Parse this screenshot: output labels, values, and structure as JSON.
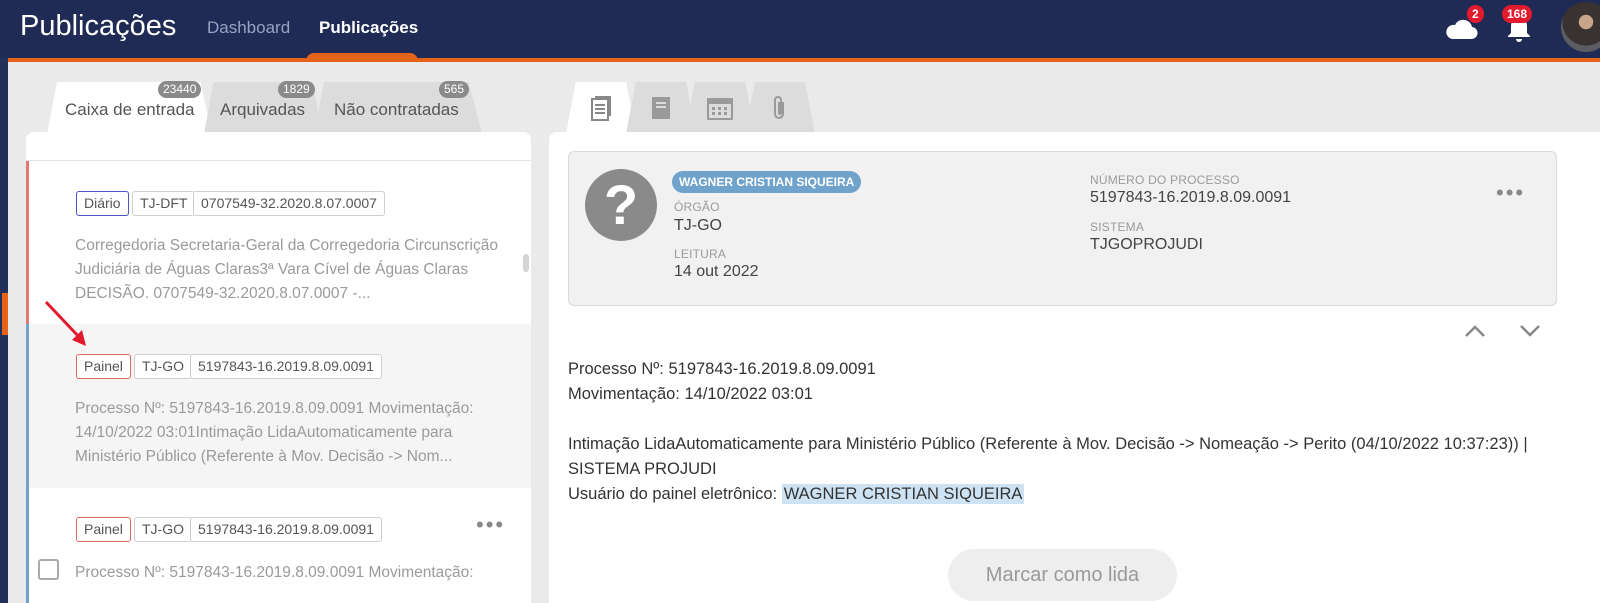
{
  "header": {
    "app_title": "Publicações",
    "nav": [
      {
        "label": "Dashboard",
        "active": false
      },
      {
        "label": "Publicações",
        "active": true
      }
    ],
    "cloud_badge": "2",
    "bell_badge": "168",
    "accent_color": "#e3631a",
    "bar_color": "#1f2a55"
  },
  "tabs": [
    {
      "label": "Caixa de entrada",
      "count": "23440",
      "active": true
    },
    {
      "label": "Arquivadas",
      "count": "1829",
      "active": false
    },
    {
      "label": "Não contratadas",
      "count": "565",
      "active": false
    }
  ],
  "list": {
    "items": [
      {
        "tags": [
          "Diário",
          "TJ-DFT",
          "0707549-32.2020.8.07.0007"
        ],
        "snippet": [
          "Corregedoria Secretaria-Geral da Corregedoria Circunscrição",
          "Judiciária de Águas Claras3ª Vara Cível de Águas Claras",
          "DECISÃO. 0707549-32.2020.8.07.0007 -..."
        ]
      },
      {
        "tags": [
          "Painel",
          "TJ-GO",
          "5197843-16.2019.8.09.0091"
        ],
        "snippet": [
          "Processo Nº: 5197843-16.2019.8.09.0091 Movimentação:",
          "14/10/2022 03:01Intimação LidaAutomaticamente para",
          "Ministério Público (Referente à Mov. Decisão -> Nom..."
        ]
      },
      {
        "tags": [
          "Painel",
          "TJ-GO",
          "5197843-16.2019.8.09.0091"
        ],
        "snippet": [
          "Processo Nº: 5197843-16.2019.8.09.0091 Movimentação:"
        ]
      }
    ]
  },
  "detail": {
    "tab_icons": [
      "document-icon",
      "book-icon",
      "calendar-icon",
      "paperclip-icon"
    ],
    "name": "WAGNER CRISTIAN SIQUEIRA",
    "orgao_label": "ÓRGÃO",
    "orgao": "TJ-GO",
    "leitura_label": "LEITURA",
    "leitura": "14 out 2022",
    "numero_label": "NÚMERO DO PROCESSO",
    "numero": "5197843-16.2019.8.09.0091",
    "sistema_label": "SISTEMA",
    "sistema": "TJGOPROJUDI",
    "body": {
      "line1": "Processo Nº: 5197843-16.2019.8.09.0091",
      "line2": "Movimentação: 14/10/2022 03:01",
      "line3": "Intimação LidaAutomaticamente para Ministério Público (Referente à Mov. Decisão -> Nomeação -> Perito (04/10/2022 10:37:23)) |",
      "line4": "SISTEMA PROJUDI",
      "line5_prefix": "Usuário do painel eletrônico: ",
      "line5_highlight": "WAGNER CRISTIAN SIQUEIRA"
    },
    "mark_read_button": "Marcar como lida"
  }
}
